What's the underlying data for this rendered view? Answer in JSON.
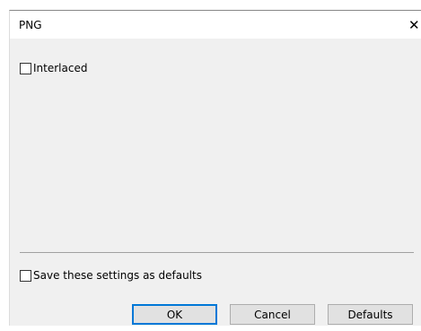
{
  "dialog": {
    "title": "PNG",
    "close_glyph": "✕"
  },
  "options": {
    "interlaced_label": "Interlaced",
    "interlaced_checked": false
  },
  "footer": {
    "save_defaults_label": "Save these settings as defaults",
    "save_defaults_checked": false
  },
  "buttons": {
    "ok_label": "OK",
    "cancel_label": "Cancel",
    "defaults_label": "Defaults"
  },
  "colors": {
    "dialog_background": "#f0f0f0",
    "titlebar_background": "#ffffff",
    "default_button_border": "#0078d7",
    "button_background": "#e1e1e1"
  }
}
